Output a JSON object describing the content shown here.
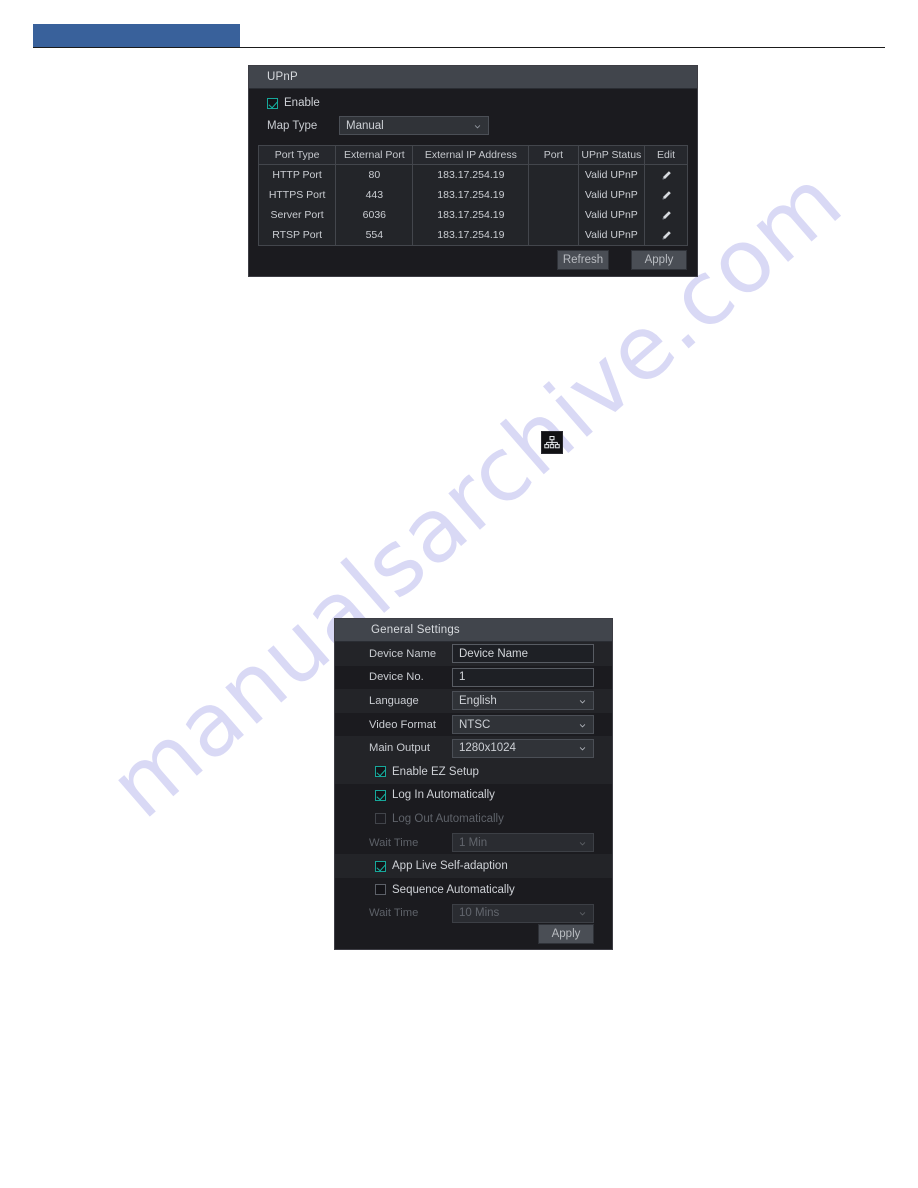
{
  "watermark": {
    "text": "manualsarchive.com"
  },
  "header": {
    "banner_color": "#39619b"
  },
  "icons": {
    "network_topology": "network-topology-icon",
    "edit_pencil": "pencil-icon",
    "chevron_down": "chevron-down-icon"
  },
  "upnp_panel": {
    "title": "UPnP",
    "enable": {
      "label": "Enable",
      "checked": true
    },
    "map_type": {
      "label": "Map Type",
      "value": "Manual"
    },
    "table": {
      "columns": [
        "Port Type",
        "External Port",
        "External IP Address",
        "Port",
        "UPnP Status",
        "Edit"
      ],
      "rows": [
        {
          "port_type": "HTTP Port",
          "external_port": "80",
          "external_ip": "183.17.254.19",
          "port": "",
          "status": "Valid UPnP"
        },
        {
          "port_type": "HTTPS Port",
          "external_port": "443",
          "external_ip": "183.17.254.19",
          "port": "",
          "status": "Valid UPnP"
        },
        {
          "port_type": "Server Port",
          "external_port": "6036",
          "external_ip": "183.17.254.19",
          "port": "",
          "status": "Valid UPnP"
        },
        {
          "port_type": "RTSP Port",
          "external_port": "554",
          "external_ip": "183.17.254.19",
          "port": "",
          "status": "Valid UPnP"
        }
      ]
    },
    "refresh_label": "Refresh",
    "apply_label": "Apply"
  },
  "general_settings_panel": {
    "title": "General Settings",
    "device_name": {
      "label": "Device Name",
      "value": "Device Name"
    },
    "device_no": {
      "label": "Device No.",
      "value": "1"
    },
    "language": {
      "label": "Language",
      "value": "English"
    },
    "video_format": {
      "label": "Video Format",
      "value": "NTSC"
    },
    "main_output": {
      "label": "Main Output",
      "value": "1280x1024"
    },
    "enable_ez_setup": {
      "label": "Enable EZ Setup",
      "checked": true,
      "disabled": false
    },
    "log_in_automatically": {
      "label": "Log In Automatically",
      "checked": true,
      "disabled": false
    },
    "log_out_automatically": {
      "label": "Log Out Automatically",
      "checked": false,
      "disabled": true
    },
    "wait_time_logout": {
      "label": "Wait Time",
      "value": "1 Min",
      "disabled": true
    },
    "app_live_self_adaption": {
      "label": "App Live Self-adaption",
      "checked": true,
      "disabled": false
    },
    "sequence_automatically": {
      "label": "Sequence Automatically",
      "checked": false,
      "disabled": false
    },
    "wait_time_sequence": {
      "label": "Wait Time",
      "value": "10 Mins",
      "disabled": true
    },
    "apply_label": "Apply"
  }
}
